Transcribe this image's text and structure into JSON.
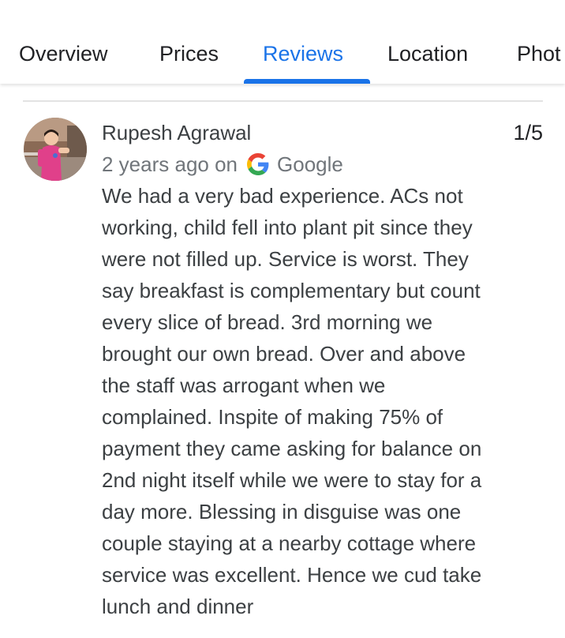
{
  "tabs": [
    {
      "label": "Overview",
      "active": false
    },
    {
      "label": "Prices",
      "active": false
    },
    {
      "label": "Reviews",
      "active": true
    },
    {
      "label": "Location",
      "active": false
    },
    {
      "label": "Phot",
      "active": false
    }
  ],
  "review": {
    "author": "Rupesh Agrawal",
    "time": "2 years ago on",
    "source": "Google",
    "rating": "1/5",
    "text": "We had a very bad experience. ACs not working, child fell into plant pit since they were not filled up. Service is worst. They say breakfast is complementary but count every slice of bread. 3rd morning we brought our own bread. Over and above the staff was arrogant when we complained. Inspite of making 75% of payment they came asking for balance on 2nd night itself while we were to stay for a day more. Blessing in disguise was one couple staying at a nearby cottage where service was excellent. Hence we cud take lunch and dinner"
  },
  "colors": {
    "accent": "#1a73e8",
    "text_primary": "#202124",
    "text_secondary": "#70757a"
  },
  "icons": {
    "source_logo": "google-g-icon",
    "avatar": "user-avatar-photo"
  }
}
